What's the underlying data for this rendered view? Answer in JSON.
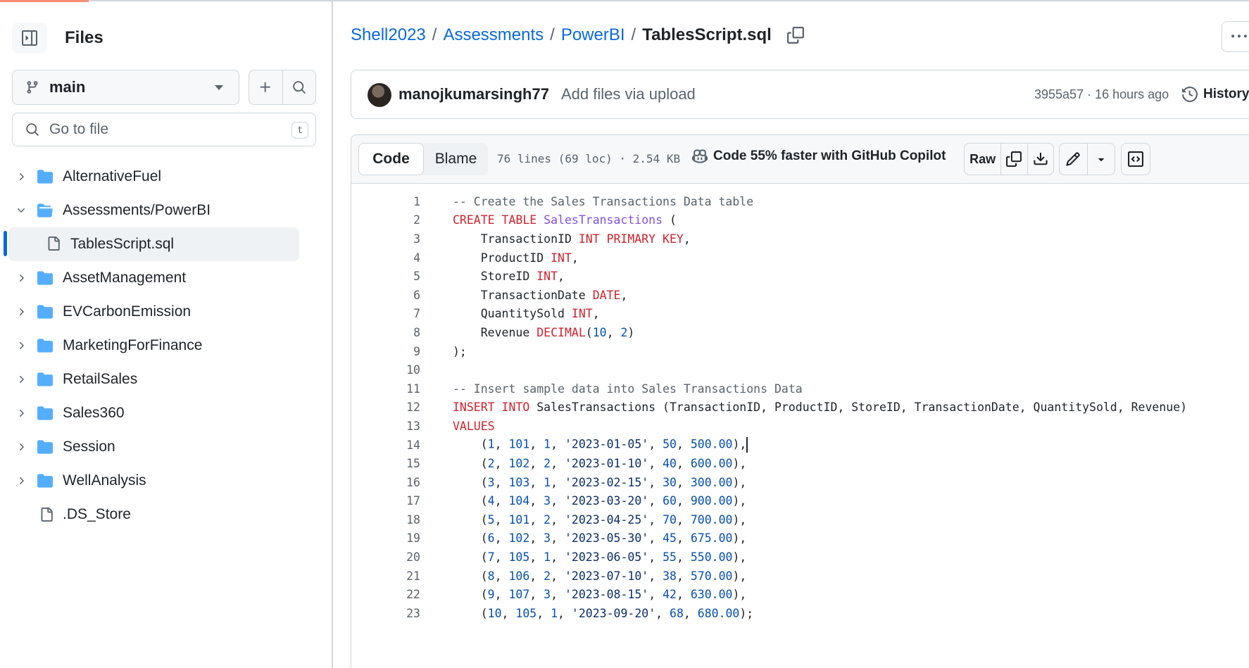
{
  "sidebar": {
    "title": "Files",
    "branch": "main",
    "goto_placeholder": "Go to file",
    "goto_shortcut": "t",
    "tree": [
      {
        "type": "folder",
        "label": "AlternativeFuel",
        "expanded": false
      },
      {
        "type": "folder",
        "label": "Assessments/PowerBI",
        "expanded": true
      },
      {
        "type": "file",
        "label": "TablesScript.sql",
        "active": true
      },
      {
        "type": "folder",
        "label": "AssetManagement",
        "expanded": false
      },
      {
        "type": "folder",
        "label": "EVCarbonEmission",
        "expanded": false
      },
      {
        "type": "folder",
        "label": "MarketingForFinance",
        "expanded": false
      },
      {
        "type": "folder",
        "label": "RetailSales",
        "expanded": false
      },
      {
        "type": "folder",
        "label": "Sales360",
        "expanded": false
      },
      {
        "type": "folder",
        "label": "Session",
        "expanded": false
      },
      {
        "type": "folder",
        "label": "WellAnalysis",
        "expanded": false
      },
      {
        "type": "file",
        "label": ".DS_Store"
      }
    ]
  },
  "breadcrumb": {
    "repo": "Shell2023",
    "folder1": "Assessments",
    "folder2": "PowerBI",
    "file": "TablesScript.sql",
    "sep": "/"
  },
  "commit": {
    "author": "manojkumarsingh77",
    "message": "Add files via upload",
    "meta": "3955a57 · 16 hours ago",
    "history_label": "History"
  },
  "file_header": {
    "tab_code": "Code",
    "tab_blame": "Blame",
    "info": "76 lines (69 loc) · 2.54 KB",
    "copilot": "Code 55% faster with GitHub Copilot",
    "raw": "Raw"
  },
  "code_lines": [
    "-- Create the Sales Transactions Data table",
    "CREATE TABLE SalesTransactions (",
    "    TransactionID INT PRIMARY KEY,",
    "    ProductID INT,",
    "    StoreID INT,",
    "    TransactionDate DATE,",
    "    QuantitySold INT,",
    "    Revenue DECIMAL(10, 2)",
    ");",
    "",
    "-- Insert sample data into Sales Transactions Data",
    "INSERT INTO SalesTransactions (TransactionID, ProductID, StoreID, TransactionDate, QuantitySold, Revenue)",
    "VALUES",
    "    (1, 101, 1, '2023-01-05', 50, 500.00),",
    "    (2, 102, 2, '2023-01-10', 40, 600.00),",
    "    (3, 103, 1, '2023-02-15', 30, 300.00),",
    "    (4, 104, 3, '2023-03-20', 60, 900.00),",
    "    (5, 101, 2, '2023-04-25', 70, 700.00),",
    "    (6, 102, 3, '2023-05-30', 45, 675.00),",
    "    (7, 105, 1, '2023-06-05', 55, 550.00),",
    "    (8, 106, 2, '2023-07-10', 38, 570.00),",
    "    (9, 107, 3, '2023-08-15', 42, 630.00),",
    "    (10, 105, 1, '2023-09-20', 68, 680.00);"
  ],
  "colors": {
    "link": "#0969da",
    "keyword": "#cf222e",
    "entity": "#8250df",
    "number": "#0550ae",
    "string": "#0a3069",
    "comment": "#59636e",
    "accent_tab": "#fd8c73"
  }
}
